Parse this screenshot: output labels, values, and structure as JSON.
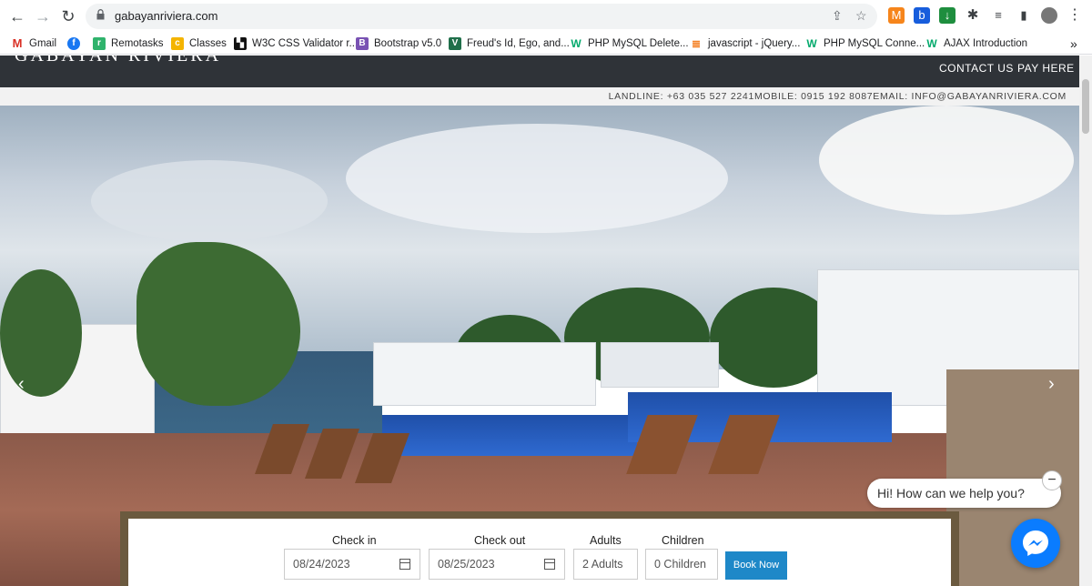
{
  "browser": {
    "url": "gabayanriviera.com",
    "bookmarks": [
      {
        "label": "Gmail",
        "icon": "gmail-icon",
        "color": "#d93025"
      },
      {
        "label": "",
        "icon": "facebook-icon",
        "color": "#1877f2"
      },
      {
        "label": "Remotasks",
        "icon": "remotasks-icon",
        "color": "#2fb36c"
      },
      {
        "label": "Classes",
        "icon": "classroom-icon",
        "color": "#f4b400"
      },
      {
        "label": "W3C CSS Validator r...",
        "icon": "w3c-icon",
        "color": "#111"
      },
      {
        "label": "Bootstrap v5.0",
        "icon": "bootstrap-icon",
        "color": "#7952b3"
      },
      {
        "label": "Freud's Id, Ego, and...",
        "icon": "verywell-icon",
        "color": "#1f6f4a"
      },
      {
        "label": "PHP MySQL Delete...",
        "icon": "w3schools-icon",
        "color": "#04aa6d"
      },
      {
        "label": "javascript - jQuery...",
        "icon": "stackoverflow-icon",
        "color": "#f48024"
      },
      {
        "label": "PHP MySQL Conne...",
        "icon": "w3schools-icon",
        "color": "#04aa6d"
      },
      {
        "label": "AJAX Introduction",
        "icon": "w3schools-icon",
        "color": "#04aa6d"
      }
    ],
    "more_bookmarks": "»"
  },
  "site": {
    "logo": "GABAYAN RIVIERA",
    "nav": [
      "CONTACT US",
      "PAY HERE"
    ],
    "contact": "LANDLINE: +63 035 527 2241MOBILE: 0915 192 8087EMAIL: INFO@GABAYANRIVIERA.COM"
  },
  "booking": {
    "checkin_label": "Check in",
    "checkin_value": "08/24/2023",
    "checkout_label": "Check out",
    "checkout_value": "08/25/2023",
    "adults_label": "Adults",
    "adults_value": "2 Adults",
    "children_label": "Children",
    "children_value": "0 Children",
    "submit": "Book Now"
  },
  "chat": {
    "greeting": "Hi! How can we help you?",
    "close": "−"
  },
  "colors": {
    "header": "#2f3338",
    "accent": "#1e88c8",
    "messenger": "#0a7cff"
  }
}
